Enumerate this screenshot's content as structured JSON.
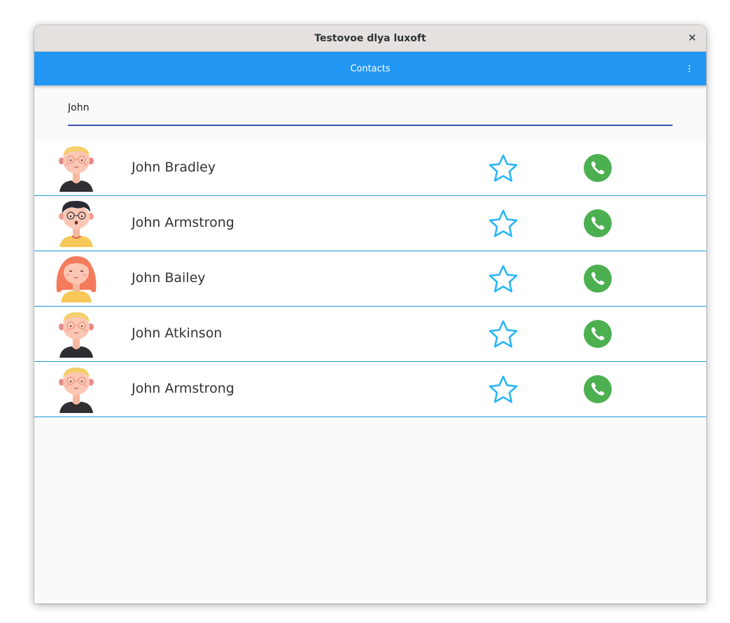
{
  "window": {
    "title": "Testovoe dlya luxoft",
    "close_glyph": "✕"
  },
  "appbar": {
    "title": "Contacts"
  },
  "search": {
    "value": "John"
  },
  "colors": {
    "appbar": "#2196f3",
    "underline": "#3f51b5",
    "divider": "#1e9ad6",
    "star": "#29b6f6",
    "call": "#4caf50"
  },
  "contacts": [
    {
      "name": "John Bradley",
      "avatar": "blond-man-avatar",
      "favorite": false
    },
    {
      "name": "John Armstrong",
      "avatar": "dark-haired-man-avatar",
      "favorite": false
    },
    {
      "name": "John Bailey",
      "avatar": "red-haired-woman-avatar",
      "favorite": false
    },
    {
      "name": "John Atkinson",
      "avatar": "blond-man-avatar",
      "favorite": false
    },
    {
      "name": "John Armstrong",
      "avatar": "blond-man-avatar",
      "favorite": false
    }
  ]
}
